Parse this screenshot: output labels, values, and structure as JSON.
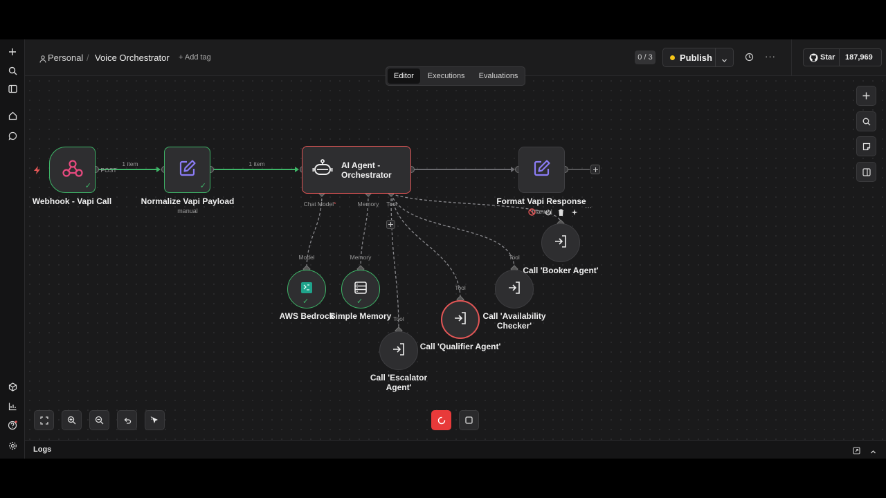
{
  "header": {
    "workspace": "Personal",
    "separator": "/",
    "workflow_name": "Voice Orchestrator",
    "add_tag": "+ Add tag",
    "version_counter": "0 / 3",
    "publish_label": "Publish",
    "github_star_label": "Star",
    "github_star_count": "187,969"
  },
  "tabs": [
    {
      "label": "Editor",
      "active": true
    },
    {
      "label": "Executions",
      "active": false
    },
    {
      "label": "Evaluations",
      "active": false
    }
  ],
  "nodes": {
    "webhook": {
      "label": "Webhook - Vapi Call",
      "output": "POST"
    },
    "normalize": {
      "label": "Normalize Vapi Payload",
      "sublabel": "manual"
    },
    "agent": {
      "label_line1": "AI Agent -",
      "label_line2": "Orchestrator",
      "port_chat_model": "Chat Model",
      "port_memory": "Memory",
      "port_tool": "Tool"
    },
    "format": {
      "label": "Format Vapi Response",
      "sublabel": "manual"
    },
    "bedrock": {
      "label": "AWS Bedrock",
      "port": "Model"
    },
    "memory": {
      "label": "Simple Memory",
      "port": "Memory"
    },
    "escalator": {
      "label_line1": "Call 'Escalator",
      "label_line2": "Agent'",
      "port": "Tool"
    },
    "qualifier": {
      "label": "Call 'Qualifier Agent'",
      "port": "Tool"
    },
    "availability": {
      "label_line1": "Call 'Availability",
      "label_line2": "Checker'",
      "port": "Tool"
    },
    "booker": {
      "label": "Call 'Booker Agent'"
    }
  },
  "edges": {
    "item_count_1": "1 item",
    "item_count_2": "1 item"
  },
  "footer": {
    "logs_label": "Logs"
  },
  "colors": {
    "success": "#3eb668",
    "error": "#e35656",
    "accent_purple": "#8b7cf6",
    "webhook_pink": "#e84a7f",
    "publish_dot": "#f5c518"
  }
}
